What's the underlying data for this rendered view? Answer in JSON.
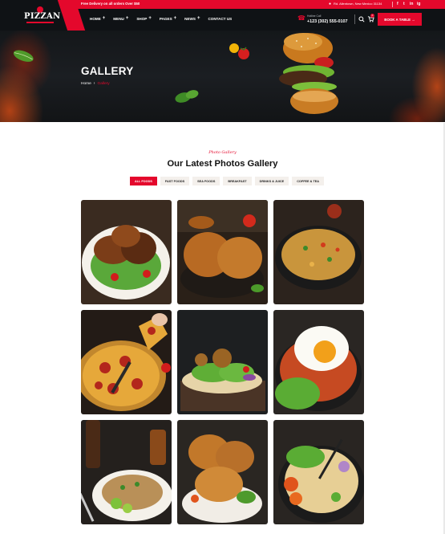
{
  "topbar": {
    "promo": "Free Delivery on all orders Over $50",
    "address": "Rd. Allentown, New Mexico 31134",
    "social": [
      "f",
      "t",
      "in",
      "ig"
    ]
  },
  "header": {
    "logo": "PIZZAN",
    "nav": [
      {
        "label": "HOME",
        "has_dropdown": true
      },
      {
        "label": "MENU",
        "has_dropdown": true
      },
      {
        "label": "SHOP",
        "has_dropdown": true
      },
      {
        "label": "PAGES",
        "has_dropdown": true
      },
      {
        "label": "NEWS",
        "has_dropdown": true
      },
      {
        "label": "CONTACT US",
        "has_dropdown": false
      }
    ],
    "phone_label": "Hotline Call",
    "phone": "+123 (302) 555-0107",
    "cart_count": "0",
    "book_button": "BOOK A TABLE"
  },
  "hero": {
    "title": "GALLERY",
    "breadcrumb_home": "Home",
    "breadcrumb_current": "Gallery"
  },
  "section": {
    "subtitle": "Photo Gallery",
    "title": "Our Latest Photos Gallery",
    "filters": [
      "ALL FOODS",
      "FAST FOODS",
      "SEA FOODS",
      "BREAKFAST",
      "DRINKS & JUICE",
      "COFFEE & TEA"
    ],
    "active_filter": "ALL FOODS"
  },
  "gallery": [
    {
      "subject": "grilled chicken with salad"
    },
    {
      "subject": "roast chicken"
    },
    {
      "subject": "fried rice bowl"
    },
    {
      "subject": "pepperoni pizza"
    },
    {
      "subject": "taco wraps"
    },
    {
      "subject": "fried rice with egg"
    },
    {
      "subject": "noodle plate with lime"
    },
    {
      "subject": "fried chicken"
    },
    {
      "subject": "noodle bowl with vegetables"
    }
  ],
  "colors": {
    "accent": "#e4082c",
    "dark": "#0f1215",
    "chip": "#f4f0ec"
  }
}
